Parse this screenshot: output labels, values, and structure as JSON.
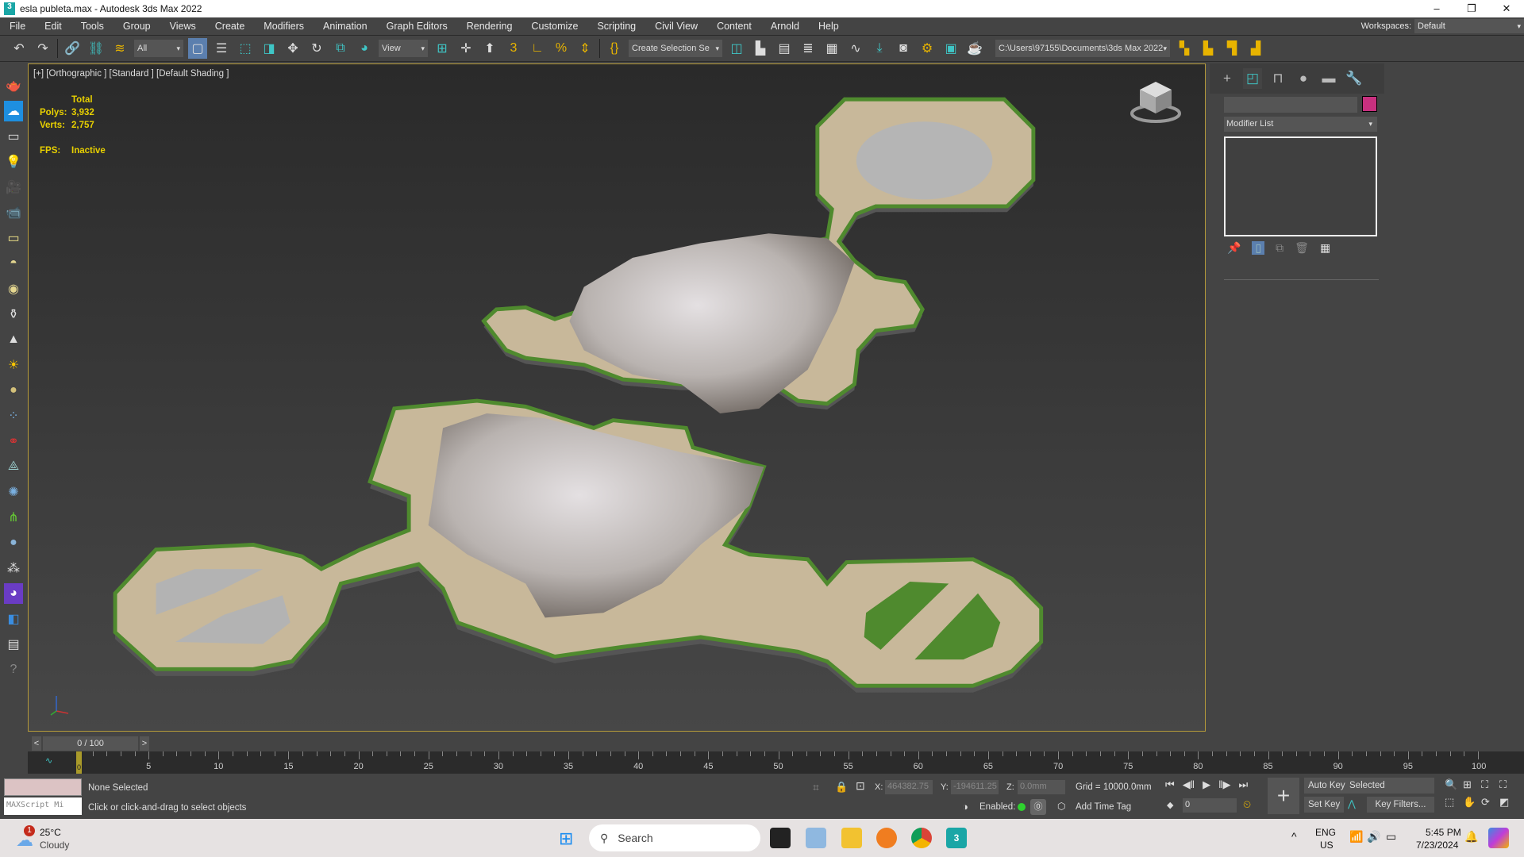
{
  "window": {
    "title": "esla publeta.max - Autodesk 3ds Max 2022",
    "minimize": "–",
    "maximize": "❐",
    "close": "✕"
  },
  "menu": [
    "File",
    "Edit",
    "Tools",
    "Group",
    "Views",
    "Create",
    "Modifiers",
    "Animation",
    "Graph Editors",
    "Rendering",
    "Customize",
    "Scripting",
    "Civil View",
    "Content",
    "Arnold",
    "Help"
  ],
  "workspace": {
    "label": "Workspaces:",
    "value": "Default"
  },
  "toolbar": {
    "selection_filter": "All",
    "ref_coord": "View",
    "named_selection": "Create Selection Se",
    "project_path": "C:\\Users\\97155\\Documents\\3ds Max 2022"
  },
  "viewport": {
    "label": "[+] [Orthographic ] [Standard ] [Default Shading ]",
    "stats": {
      "total": "Total",
      "polys_label": "Polys:",
      "polys": "3,932",
      "verts_label": "Verts:",
      "verts": "2,757",
      "fps_label": "FPS:",
      "fps": "Inactive"
    },
    "colors": {
      "platform": "#c8b89a",
      "edge": "#4f8a2e",
      "rock": "#cfcbc9"
    }
  },
  "command_panel": {
    "modifier_list": "Modifier List",
    "object_color": "#c8307f"
  },
  "time": {
    "counter": "0 / 100",
    "prev": "<",
    "next": ">",
    "start": 0,
    "end": 100,
    "step": 5
  },
  "status": {
    "maxscript": "MAXScript Mi",
    "selection": "None Selected",
    "prompt": "Click or click-and-drag to select objects",
    "x_label": "X:",
    "x": "464382.75",
    "y_label": "Y:",
    "y": "-194611.25",
    "z_label": "Z:",
    "z": "0.0mm",
    "grid": "Grid = 10000.0mm",
    "enabled": "Enabled:",
    "add_time_tag": "Add Time Tag",
    "auto_key": "Auto Key",
    "set_key": "Set Key",
    "key_mode": "Selected",
    "key_filters": "Key Filters...",
    "frame": "0"
  },
  "taskbar": {
    "weather_temp": "25°C",
    "weather_desc": "Cloudy",
    "weather_badge": "1",
    "search": "Search",
    "lang1": "ENG",
    "lang2": "US",
    "time": "5:45 PM",
    "date": "7/23/2024"
  }
}
